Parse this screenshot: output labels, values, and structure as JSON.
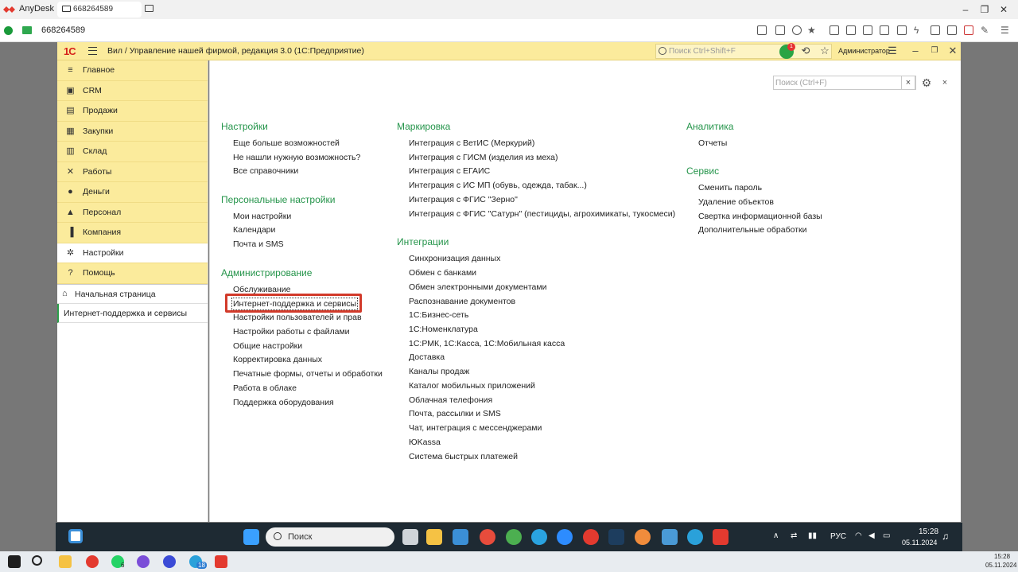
{
  "anydesk": {
    "app_name": "AnyDesk",
    "tab_label": "668264589",
    "address": "668264589"
  },
  "onec": {
    "logo": "1С",
    "window_title": "Вил / Управление нашей фирмой, редакция 3.0  (1С:Предприятие)",
    "search_placeholder": "Поиск Ctrl+Shift+F",
    "notification_count": "1",
    "user": "Администратор"
  },
  "sidebar": {
    "sections": [
      {
        "label": "Главное",
        "icon": "≡"
      },
      {
        "label": "CRM",
        "icon": "▣"
      },
      {
        "label": "Продажи",
        "icon": "▤"
      },
      {
        "label": "Закупки",
        "icon": "▦"
      },
      {
        "label": "Склад",
        "icon": "▥"
      },
      {
        "label": "Работы",
        "icon": "✕"
      },
      {
        "label": "Деньги",
        "icon": "●"
      },
      {
        "label": "Персонал",
        "icon": "▲"
      },
      {
        "label": "Компания",
        "icon": "▐"
      },
      {
        "label": "Настройки",
        "icon": "✲"
      },
      {
        "label": "Помощь",
        "icon": "?"
      }
    ],
    "open": [
      {
        "label": "Начальная страница",
        "icon": "⌂"
      },
      {
        "label": "Интернет-поддержка и сервисы",
        "icon": ""
      }
    ]
  },
  "panel": {
    "search_placeholder": "Поиск (Ctrl+F)",
    "clear": "×",
    "close": "×"
  },
  "groups": {
    "settings": {
      "title": "Настройки",
      "links": [
        "Еще больше возможностей",
        "Не нашли нужную возможность?",
        "Все справочники"
      ]
    },
    "personal": {
      "title": "Персональные настройки",
      "links": [
        "Мои настройки",
        "Календари",
        "Почта и SMS"
      ]
    },
    "admin": {
      "title": "Администрирование",
      "links": [
        "Обслуживание",
        "Интернет-поддержка и сервисы",
        "Настройки пользователей и прав",
        "Настройки работы с файлами",
        "Общие настройки",
        "Корректировка данных",
        "Печатные формы, отчеты и обработки",
        "Работа в облаке",
        "Поддержка оборудования"
      ]
    },
    "marking": {
      "title": "Маркировка",
      "links": [
        "Интеграция с ВетИС (Меркурий)",
        "Интеграция с ГИСМ (изделия из меха)",
        "Интеграция с ЕГАИС",
        "Интеграция с ИС МП (обувь, одежда, табак...)",
        "Интеграция с ФГИС \"Зерно\"",
        "Интеграция с ФГИС \"Сатурн\" (пестициды, агрохимикаты, тукосмеси)"
      ]
    },
    "integrations": {
      "title": "Интеграции",
      "links": [
        "Синхронизация данных",
        "Обмен с банками",
        "Обмен электронными документами",
        "Распознавание документов",
        "1С:Бизнес-сеть",
        "1С:Номенклатура",
        "1С:РМК, 1С:Касса, 1С:Мобильная касса",
        "Доставка",
        "Каналы продаж",
        "Каталог мобильных приложений",
        "Облачная телефония",
        "Почта, рассылки и SMS",
        "Чат, интеграция с мессенджерами",
        "ЮKassa",
        "Система быстрых платежей"
      ]
    },
    "analytics": {
      "title": "Аналитика",
      "links": [
        "Отчеты"
      ]
    },
    "service": {
      "title": "Сервис",
      "links": [
        "Сменить пароль",
        "Удаление объектов",
        "Свертка информационной базы",
        "Дополнительные обработки"
      ]
    }
  },
  "remote_taskbar": {
    "search_label": "Поиск",
    "lang": "РУС",
    "time": "15:28",
    "date": "05.11.2024"
  },
  "local_taskbar": {
    "time": "15:28",
    "date": "05.11.2024",
    "whatsapp_badge": "6",
    "telegram_badge": "18"
  },
  "colors": {
    "onec_yellow": "#fbeb9c",
    "group_green": "#24944a",
    "highlight_red": "#d23a2a"
  }
}
